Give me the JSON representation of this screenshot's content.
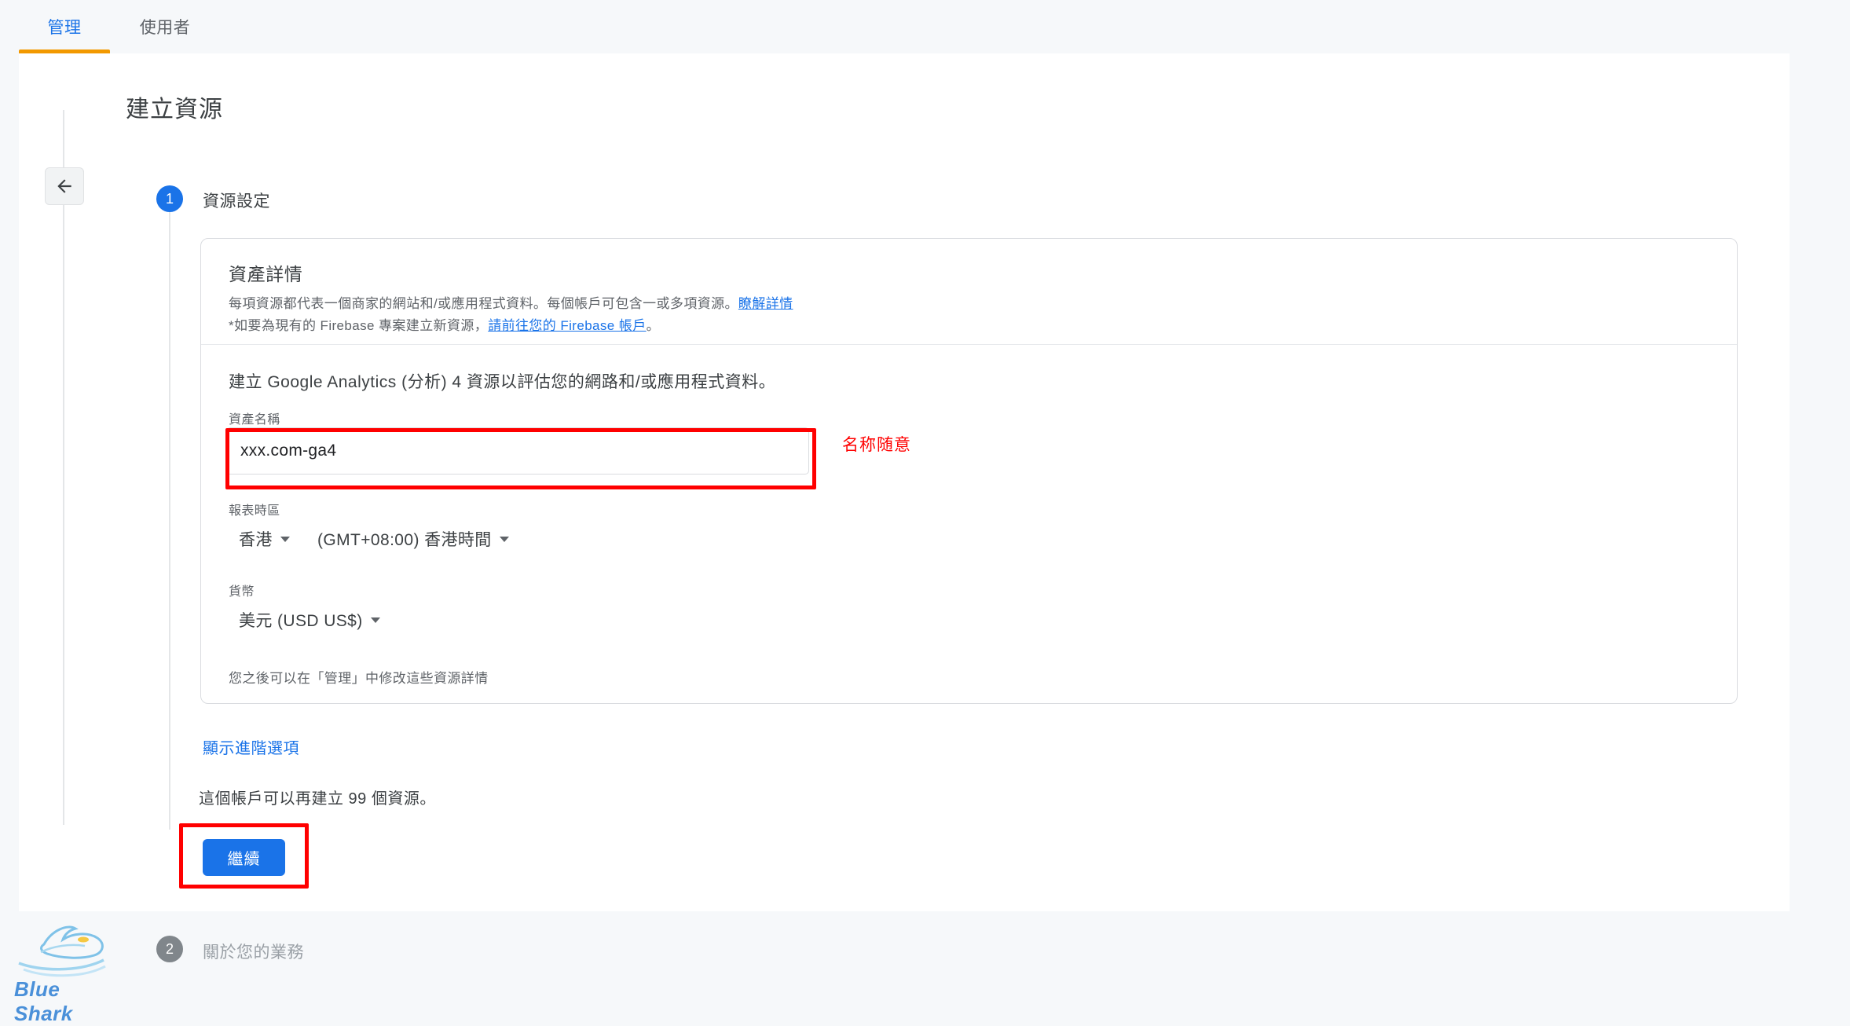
{
  "tabs": [
    {
      "label": "管理",
      "active": true
    },
    {
      "label": "使用者",
      "active": false
    }
  ],
  "page": {
    "title": "建立資源"
  },
  "nav": {
    "back_icon": "arrow-left-icon"
  },
  "stepper": {
    "step1": {
      "number": "1",
      "label": "資源設定"
    },
    "step2": {
      "number": "2",
      "label": "關於您的業務"
    }
  },
  "card": {
    "title": "資產詳情",
    "desc_line1_a": "每項資源都代表一個商家的網站和/或應用程式資料。每個帳戶可包含一或多項資源。",
    "desc_line1_link": "瞭解詳情",
    "desc_line2_a": "*如要為現有的 Firebase 專案建立新資源，",
    "desc_line2_link": "請前往您的 Firebase 帳戶",
    "desc_line2_b": "。",
    "intro": "建立 Google Analytics (分析) 4 資源以評估您的網路和/或應用程式資料。",
    "name_label": "資產名稱",
    "name_value": "xxx.com-ga4",
    "name_placeholder": "資產名稱",
    "timezone_label": "報表時區",
    "timezone_country": "香港",
    "timezone_zone": "(GMT+08:00) 香港時間",
    "currency_label": "貨幣",
    "currency_value": "美元 (USD US$)",
    "footnote": "您之後可以在「管理」中修改這些資源詳情"
  },
  "below": {
    "advanced_link": "顯示進階選項",
    "quota_text": "這個帳戶可以再建立 99 個資源。",
    "continue_label": "繼續"
  },
  "annotations": {
    "name_note": "名称随意",
    "color": "#ff0000"
  },
  "watermark": {
    "text": "Blue Shark",
    "icon": "shark-logo-icon"
  },
  "colors": {
    "accent_blue": "#1a73e8",
    "tab_underline_orange": "#f29900",
    "annotation_red": "#ff0000",
    "surface": "#ffffff",
    "page_bg": "#f6f8fa"
  }
}
